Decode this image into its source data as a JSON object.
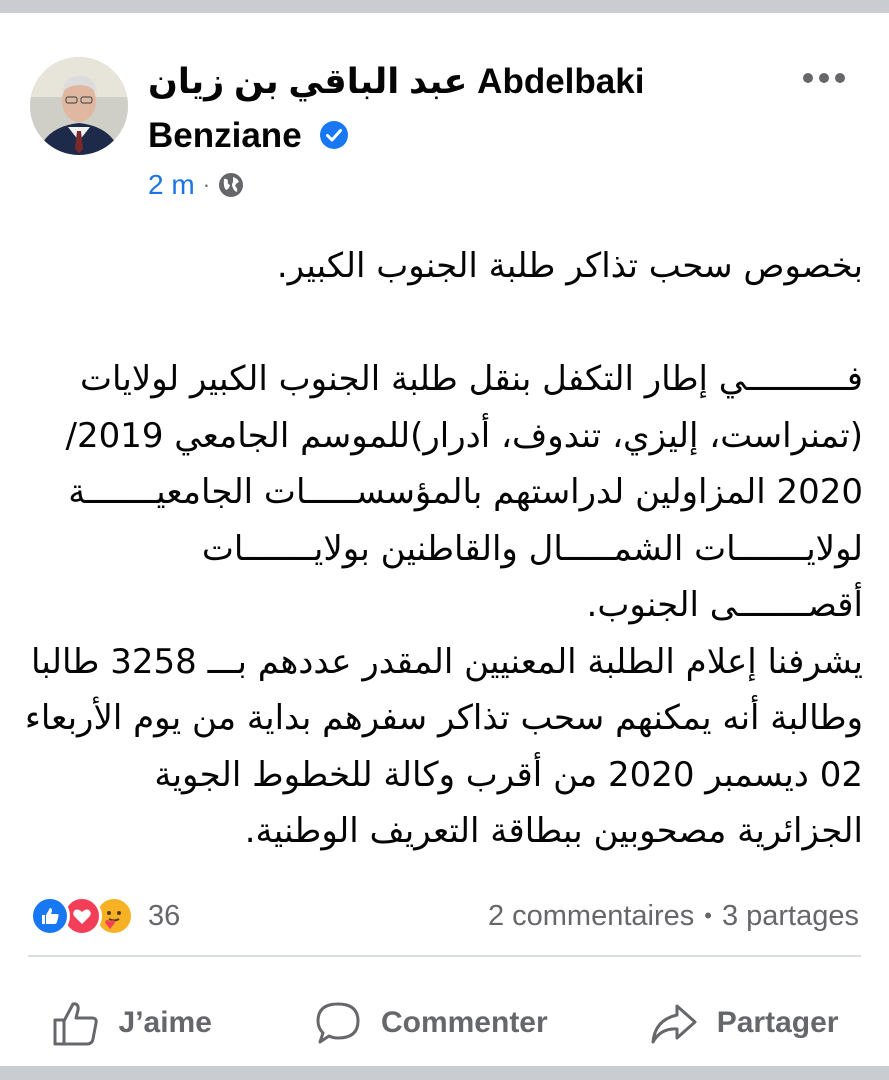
{
  "post": {
    "author_name_arabic": "عبد الباقي بن زيان",
    "author_name_latin_1": "Abdelbaki",
    "author_name_latin_2": "Benziane",
    "verified_icon": "verified-badge-icon",
    "time": "2 m",
    "separator": "·",
    "audience_icon": "globe-icon",
    "more_icon": "more-options-icon",
    "text_lines": [
      "بخصوص سحب تذاكر طلبة الجنوب الكبير.",
      "",
      "فــــــــــي إطار التكفل بنقل طلبة الجنوب الكبير لولايات",
      "(تمنراست، إليزي، تندوف، أدرار)للموسم الجامعي 2019/",
      "2020 المزاولين لدراستهم بالمؤسســـــات الجامعيـــــــة",
      "لولايـــــــات الشمـــــال والقاطنين بولايـــــــات",
      "أقصـــــــى الجنوب.",
      "يشرفنا إعلام الطلبة المعنيين المقدر عددهم بـــ 3258 طالبا",
      "وطالبة أنه يمكنهم سحب تذاكر سفرهم بداية من يوم الأربعاء",
      "02 ديسمبر 2020 من أقرب وكالة للخطوط الجوية",
      "الجزائرية مصحوبين ببطاقة التعريف الوطنية."
    ]
  },
  "engagement": {
    "reaction_icons": [
      "like-reaction-icon",
      "love-reaction-icon",
      "care-reaction-icon"
    ],
    "reaction_count": "36",
    "comments": "2 commentaires",
    "separator": "•",
    "shares": "3 partages"
  },
  "actions": {
    "like_label": "J’aime",
    "comment_label": "Commenter",
    "share_label": "Partager"
  },
  "colors": {
    "facebook_blue": "#1877f2",
    "love_red": "#f33e58",
    "care_yellow": "#f7b125",
    "secondary_text": "#65676b"
  }
}
